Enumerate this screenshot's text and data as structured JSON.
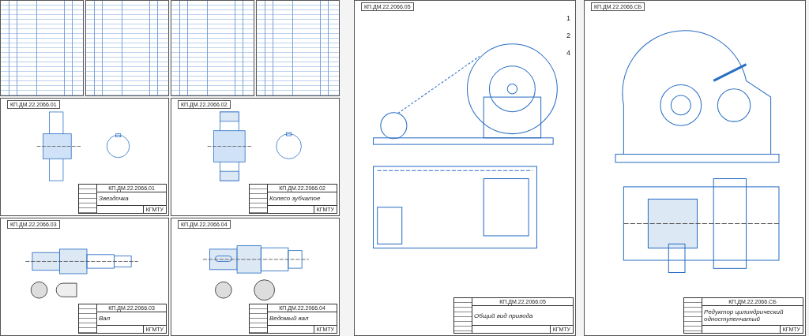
{
  "part_sheets": [
    {
      "kind": "sprocket",
      "stamp": "КП.ДМ.22.2066.01",
      "title": "Звездочка",
      "designation": "КП.ДМ.22.2066.01",
      "org": "КГМТУ"
    },
    {
      "kind": "gear",
      "stamp": "КП.ДМ.22.2066.02",
      "title": "Колесо зубчатое",
      "designation": "КП.ДМ.22.2066.02",
      "org": "КГМТУ"
    },
    {
      "kind": "shaft",
      "stamp": "КП.ДМ.22.2066.03",
      "title": "Вал",
      "designation": "КП.ДМ.22.2066.03",
      "org": "КГМТУ"
    },
    {
      "kind": "driven-shaft",
      "stamp": "КП.ДМ.22.2066.04",
      "title": "Ведомый вал",
      "designation": "КП.ДМ.22.2066.04",
      "org": "КГМТУ"
    }
  ],
  "assembly_sheets": [
    {
      "kind": "general",
      "stamp": "КП.ДМ.22.2066.05",
      "title": "Общий вид привода",
      "designation": "КП.ДМ.22.2066.05",
      "org": "КГМТУ",
      "callouts": [
        "1",
        "2",
        "4"
      ]
    },
    {
      "kind": "reducer",
      "stamp": "КП.ДМ.22.2066.СБ",
      "title": "Редуктор цилиндрический одноступенчатый",
      "designation": "КП.ДМ.22.2066.СБ",
      "org": "КГМТУ"
    }
  ]
}
